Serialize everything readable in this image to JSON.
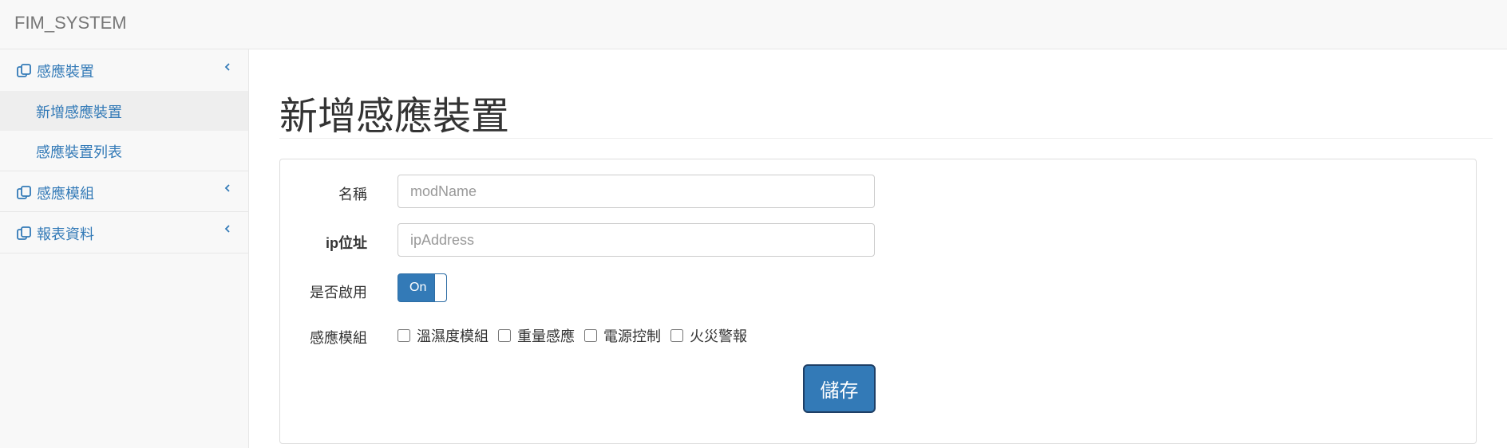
{
  "app": {
    "brand": "FIM_SYSTEM"
  },
  "sidebar": {
    "items": [
      {
        "label": "感應裝置",
        "icon": "copy-icon",
        "expanded": true,
        "children": [
          {
            "label": "新增感應裝置",
            "active": true
          },
          {
            "label": "感應裝置列表",
            "active": false
          }
        ]
      },
      {
        "label": "感應模組",
        "icon": "copy-icon"
      },
      {
        "label": "報表資料",
        "icon": "copy-icon"
      }
    ]
  },
  "page": {
    "title": "新增感應裝置"
  },
  "form": {
    "name": {
      "label": "名稱",
      "placeholder": "modName",
      "value": ""
    },
    "ip": {
      "label": "ip位址",
      "placeholder": "ipAddress",
      "value": ""
    },
    "enabled": {
      "label": "是否啟用",
      "toggle_text": "On",
      "checked": true
    },
    "modules": {
      "label": "感應模組",
      "options": [
        {
          "label": "溫濕度模組",
          "checked": false
        },
        {
          "label": "重量感應",
          "checked": false
        },
        {
          "label": "電源控制",
          "checked": false
        },
        {
          "label": "火災警報",
          "checked": false
        }
      ]
    },
    "save_label": "儲存"
  },
  "colors": {
    "accent": "#337ab7",
    "link": "#337ab7",
    "sidebar_bg": "#f8f8f8"
  }
}
